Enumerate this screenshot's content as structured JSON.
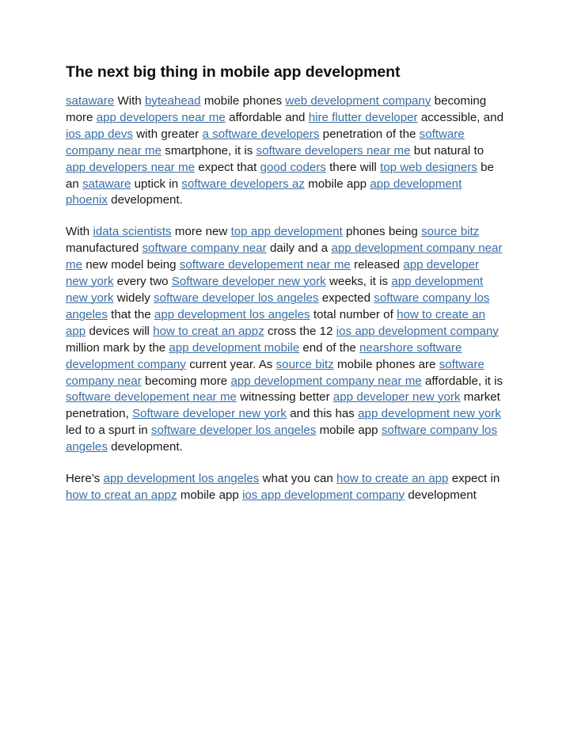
{
  "document": {
    "title": "The next big thing in mobile app development",
    "link_color": "#3a6ea5",
    "text_color": "#191919",
    "background_color": "#ffffff"
  },
  "paragraphs": [
    {
      "id": "paragraph-1",
      "runs": [
        {
          "t": "link",
          "v": "sataware"
        },
        {
          "t": "text",
          "v": " With "
        },
        {
          "t": "link",
          "v": "byteahead"
        },
        {
          "t": "text",
          "v": " mobile phones "
        },
        {
          "t": "link",
          "v": "web development company"
        },
        {
          "t": "text",
          "v": " becoming more "
        },
        {
          "t": "link",
          "v": "app developers near me"
        },
        {
          "t": "text",
          "v": " affordable and "
        },
        {
          "t": "link",
          "v": "hire flutter developer"
        },
        {
          "t": "text",
          "v": " accessible, and "
        },
        {
          "t": "link",
          "v": "ios app devs"
        },
        {
          "t": "text",
          "v": " with greater "
        },
        {
          "t": "link",
          "v": "a software developers"
        },
        {
          "t": "text",
          "v": " penetration of the "
        },
        {
          "t": "link",
          "v": "software company near me"
        },
        {
          "t": "text",
          "v": " smartphone, it is "
        },
        {
          "t": "link",
          "v": "software developers near me"
        },
        {
          "t": "text",
          "v": " but natural to "
        },
        {
          "t": "link",
          "v": "app developers near me"
        },
        {
          "t": "text",
          "v": " expect that "
        },
        {
          "t": "link",
          "v": "good coders"
        },
        {
          "t": "text",
          "v": " there will "
        },
        {
          "t": "link",
          "v": "top web designers"
        },
        {
          "t": "text",
          "v": " be an "
        },
        {
          "t": "link",
          "v": "sataware"
        },
        {
          "t": "text",
          "v": " uptick in "
        },
        {
          "t": "link",
          "v": "software developers az"
        },
        {
          "t": "text",
          "v": " mobile app "
        },
        {
          "t": "link",
          "v": "app development phoenix"
        },
        {
          "t": "text",
          "v": " development."
        }
      ]
    },
    {
      "id": "paragraph-2",
      "runs": [
        {
          "t": "text",
          "v": "With "
        },
        {
          "t": "link",
          "v": "idata scientists"
        },
        {
          "t": "text",
          "v": " more new "
        },
        {
          "t": "link",
          "v": "top app development"
        },
        {
          "t": "text",
          "v": " phones being "
        },
        {
          "t": "link",
          "v": "source bitz"
        },
        {
          "t": "text",
          "v": " manufactured "
        },
        {
          "t": "link",
          "v": "software company near"
        },
        {
          "t": "text",
          "v": " daily and a "
        },
        {
          "t": "link",
          "v": "app development company near me"
        },
        {
          "t": "text",
          "v": " new model being "
        },
        {
          "t": "link",
          "v": "software developement near me"
        },
        {
          "t": "text",
          "v": " released "
        },
        {
          "t": "link",
          "v": "app developer new york"
        },
        {
          "t": "text",
          "v": " every two "
        },
        {
          "t": "link",
          "v": "Software developer new york"
        },
        {
          "t": "text",
          "v": " weeks, it is "
        },
        {
          "t": "link",
          "v": "app development new york"
        },
        {
          "t": "text",
          "v": " widely "
        },
        {
          "t": "link",
          "v": "software developer los angeles"
        },
        {
          "t": "text",
          "v": " expected "
        },
        {
          "t": "link",
          "v": "software company los angeles"
        },
        {
          "t": "text",
          "v": " that the "
        },
        {
          "t": "link",
          "v": "app development los angeles"
        },
        {
          "t": "text",
          "v": " total number of "
        },
        {
          "t": "link",
          "v": "how to create an app"
        },
        {
          "t": "text",
          "v": " devices will "
        },
        {
          "t": "link",
          "v": "how to creat an appz"
        },
        {
          "t": "text",
          "v": " cross the 12 "
        },
        {
          "t": "link",
          "v": "ios app development company"
        },
        {
          "t": "text",
          "v": " million mark by the "
        },
        {
          "t": "link",
          "v": "app development mobile"
        },
        {
          "t": "text",
          "v": " end of the "
        },
        {
          "t": "link",
          "v": "nearshore software development company"
        },
        {
          "t": "text",
          "v": " current year. As "
        },
        {
          "t": "link",
          "v": "source bitz"
        },
        {
          "t": "text",
          "v": " mobile phones are "
        },
        {
          "t": "link",
          "v": "software company near"
        },
        {
          "t": "text",
          "v": " becoming more "
        },
        {
          "t": "link",
          "v": "app development company near me"
        },
        {
          "t": "text",
          "v": " affordable, it is "
        },
        {
          "t": "link",
          "v": "software developement near me"
        },
        {
          "t": "text",
          "v": " witnessing better "
        },
        {
          "t": "link",
          "v": "app developer new york"
        },
        {
          "t": "text",
          "v": " market penetration, "
        },
        {
          "t": "link",
          "v": "Software developer new york"
        },
        {
          "t": "text",
          "v": " and this has "
        },
        {
          "t": "link",
          "v": "app development new york"
        },
        {
          "t": "text",
          "v": " led to a spurt in "
        },
        {
          "t": "link",
          "v": "software developer los angeles"
        },
        {
          "t": "text",
          "v": " mobile app "
        },
        {
          "t": "link",
          "v": "software company los angeles"
        },
        {
          "t": "text",
          "v": " development."
        }
      ]
    },
    {
      "id": "paragraph-3",
      "runs": [
        {
          "t": "text",
          "v": "Here’s "
        },
        {
          "t": "link",
          "v": "app development los angeles"
        },
        {
          "t": "text",
          "v": " what you can "
        },
        {
          "t": "link",
          "v": "how to create an app"
        },
        {
          "t": "text",
          "v": " expect in "
        },
        {
          "t": "link",
          "v": "how to creat an appz"
        },
        {
          "t": "text",
          "v": " mobile app "
        },
        {
          "t": "link",
          "v": "ios app development company"
        },
        {
          "t": "text",
          "v": " development"
        }
      ]
    }
  ]
}
